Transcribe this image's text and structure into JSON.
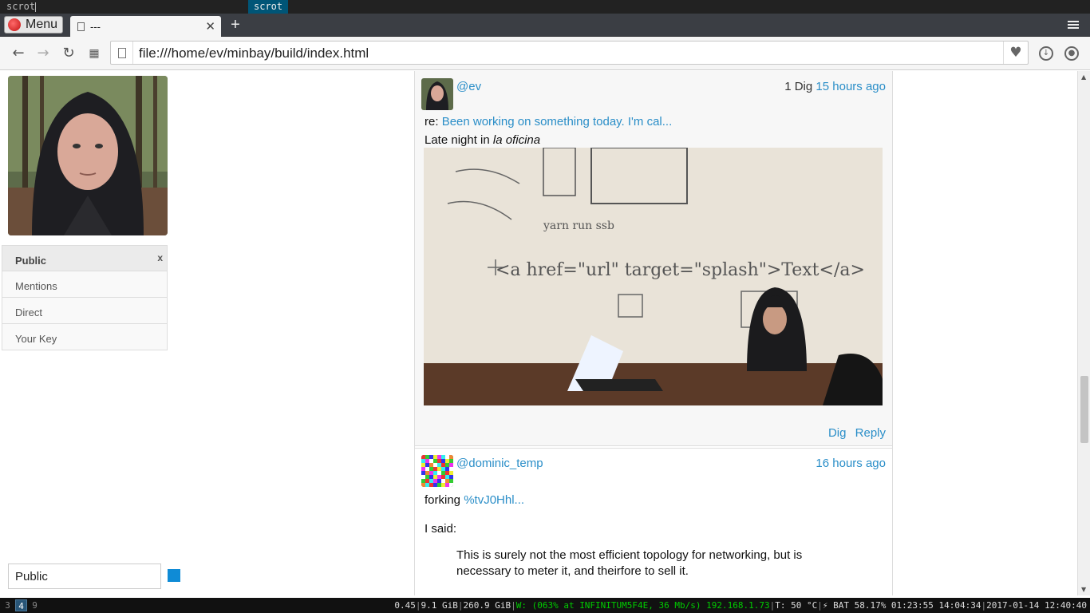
{
  "dmenu": {
    "input": "scrot",
    "match": "scrot"
  },
  "browser": {
    "menu_label": "Menu",
    "tab_title": "---",
    "url": "file:///home/ev/minbay/build/index.html"
  },
  "sidebar": {
    "nav": [
      {
        "label": "Public",
        "active": true,
        "close": "x"
      },
      {
        "label": "Mentions"
      },
      {
        "label": "Direct"
      },
      {
        "label": "Your Key"
      }
    ],
    "channel_input_value": "Public",
    "swatch_color": "#0f8bd6"
  },
  "posts": [
    {
      "author": "@ev",
      "digs": "1 Dig",
      "time": "15 hours ago",
      "reply_prefix": "re:",
      "reply_link": "Been working on something today. I'm cal...",
      "text_main": "Late night in ",
      "text_italic": "la oficina",
      "actions": {
        "dig": "Dig",
        "reply": "Reply"
      }
    },
    {
      "author": "@dominic_temp",
      "time": "16 hours ago",
      "text_prefix": "forking ",
      "text_link": "%tvJ0Hhl...",
      "said": "I said:",
      "quote": "This is surely not the most efficient topology for networking, but is necessary to meter it, and theirfore to sell it."
    }
  ],
  "statusbar": {
    "workspaces": [
      "3",
      "4",
      "9"
    ],
    "active_workspace": "4",
    "load": "0.45",
    "mem": "9.1 GiB",
    "disk": "260.9 GiB",
    "wifi": "W: (063% at INFINITUM5F4E, 36 Mb/s) 192.168.1.73",
    "temp": "T: 50 °C",
    "battery": "⚡ BAT 58.17% 01:23:55 14:04:34",
    "datetime": "2017-01-14 12:40:40"
  }
}
